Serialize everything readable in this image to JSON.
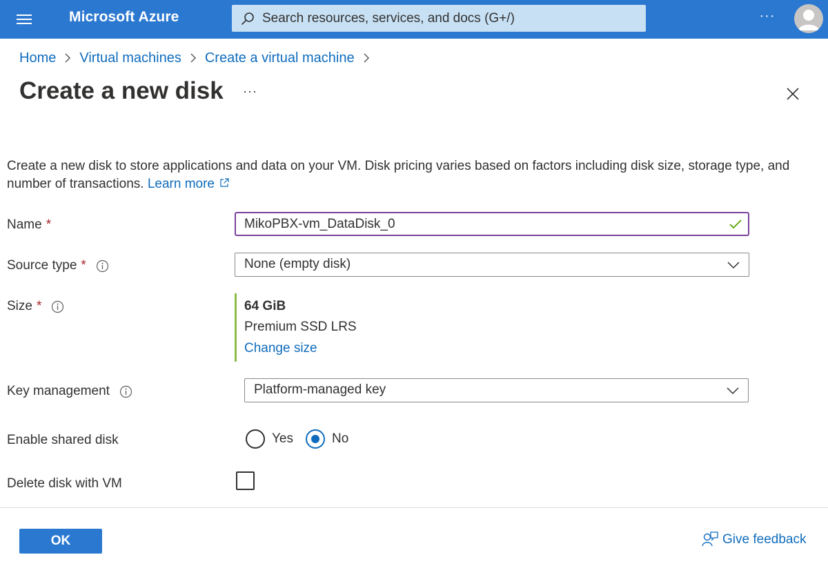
{
  "topbar": {
    "brand": "Microsoft Azure",
    "search_placeholder": "Search resources, services, and docs (G+/)",
    "more_label": "···"
  },
  "breadcrumb": {
    "items": [
      "Home",
      "Virtual machines",
      "Create a virtual machine"
    ]
  },
  "panel": {
    "title": "Create a new disk",
    "more_label": "···",
    "description": "Create a new disk to store applications and data on your VM. Disk pricing varies based on factors including disk size, storage type, and number of transactions.",
    "learn_more": "Learn more"
  },
  "form": {
    "name": {
      "label": "Name",
      "required": "*",
      "value": "MikoPBX-vm_DataDisk_0"
    },
    "source_type": {
      "label": "Source type",
      "required": "*",
      "value": "None (empty disk)"
    },
    "size": {
      "label": "Size",
      "required": "*",
      "value": "64 GiB",
      "tier": "Premium SSD LRS",
      "change_link": "Change size"
    },
    "key_management": {
      "label": "Key management",
      "value": "Platform-managed key"
    },
    "shared_disk": {
      "label": "Enable shared disk",
      "options": [
        "Yes",
        "No"
      ],
      "selected": "No"
    },
    "delete_with_vm": {
      "label": "Delete disk with VM",
      "checked": false
    }
  },
  "footer": {
    "ok_label": "OK",
    "feedback_label": "Give feedback"
  },
  "colors": {
    "header_bg": "#2b78d0",
    "link": "#0f6cbd",
    "required": "#a4262c",
    "focus_border": "#7a3f9a",
    "valid_check": "#57a300",
    "size_accent": "#8cbd4b"
  }
}
